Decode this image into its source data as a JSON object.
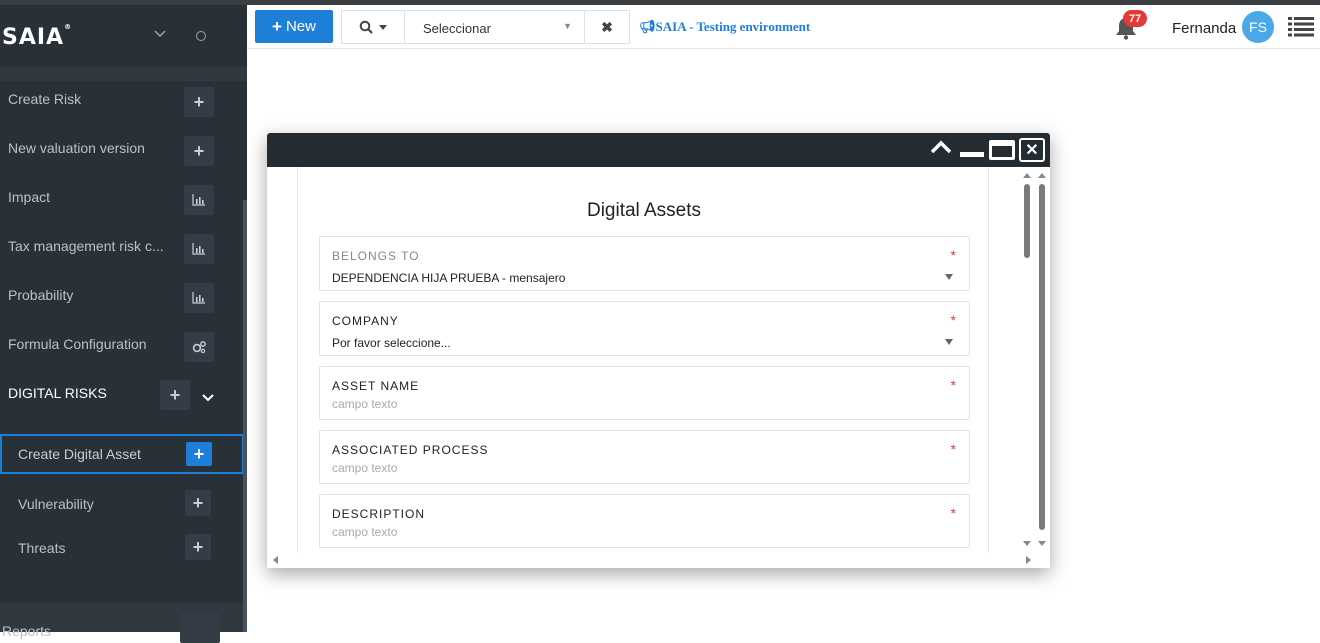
{
  "sidebar": {
    "logo": "SAIA",
    "logo_mark": "®",
    "items": [
      {
        "label": "Create Risk",
        "icon": "plus-icon"
      },
      {
        "label": "New valuation version",
        "icon": "plus-icon"
      },
      {
        "label": "Impact",
        "icon": "bar-chart-icon"
      },
      {
        "label": "Tax management risk c...",
        "icon": "bar-chart-icon"
      },
      {
        "label": "Probability",
        "icon": "bar-chart-icon"
      },
      {
        "label": "Formula Configuration",
        "icon": "gears-icon"
      }
    ],
    "section": {
      "label": "DIGITAL RISKS"
    },
    "sub_items": [
      {
        "label": "Create Digital Asset"
      },
      {
        "label": "Vulnerability"
      },
      {
        "label": "Threats"
      }
    ],
    "bottom_label": "Reports"
  },
  "topbar": {
    "new_label": "New",
    "select_value": "Seleccionar",
    "env_text": "SAIA - Testing environment",
    "notifications": "77",
    "user_name": "Fernanda",
    "avatar_initials": "FS"
  },
  "modal": {
    "title": "Digital Assets",
    "fields": [
      {
        "label": "BELONGS TO",
        "value": "DEPENDENCIA HIJA PRUEBA - mensajero",
        "required": "*"
      },
      {
        "label": "COMPANY",
        "value": "Por favor seleccione...",
        "required": "*"
      },
      {
        "label": "ASSET NAME",
        "placeholder": "campo texto",
        "required": "*"
      },
      {
        "label": "ASSOCIATED PROCESS",
        "placeholder": "campo texto",
        "required": "*"
      },
      {
        "label": "DESCRIPTION",
        "placeholder": "campo texto",
        "required": "*"
      }
    ]
  },
  "colors": {
    "accent": "#1e7fd8",
    "sidebar": "#283038",
    "required": "#e53935"
  }
}
